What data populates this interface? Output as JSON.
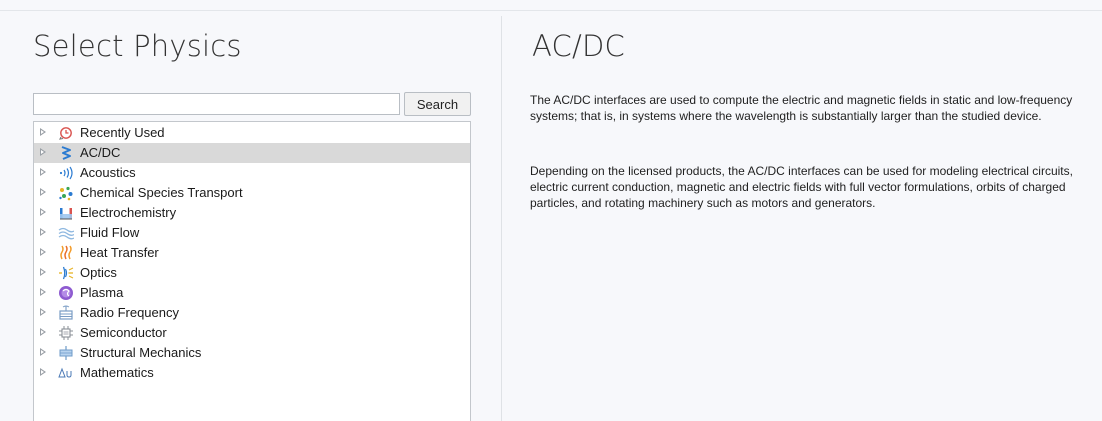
{
  "left_panel": {
    "title": "Select Physics",
    "search": {
      "value": "",
      "placeholder": "",
      "button_label": "Search"
    },
    "tree": [
      {
        "label": "Recently Used",
        "icon": "recently-used-icon",
        "selected": false
      },
      {
        "label": "AC/DC",
        "icon": "acdc-icon",
        "selected": true
      },
      {
        "label": "Acoustics",
        "icon": "acoustics-icon",
        "selected": false
      },
      {
        "label": "Chemical Species Transport",
        "icon": "chemical-species-transport-icon",
        "selected": false
      },
      {
        "label": "Electrochemistry",
        "icon": "electrochemistry-icon",
        "selected": false
      },
      {
        "label": "Fluid Flow",
        "icon": "fluid-flow-icon",
        "selected": false
      },
      {
        "label": "Heat Transfer",
        "icon": "heat-transfer-icon",
        "selected": false
      },
      {
        "label": "Optics",
        "icon": "optics-icon",
        "selected": false
      },
      {
        "label": "Plasma",
        "icon": "plasma-icon",
        "selected": false
      },
      {
        "label": "Radio Frequency",
        "icon": "radio-frequency-icon",
        "selected": false
      },
      {
        "label": "Semiconductor",
        "icon": "semiconductor-icon",
        "selected": false
      },
      {
        "label": "Structural Mechanics",
        "icon": "structural-mechanics-icon",
        "selected": false
      },
      {
        "label": "Mathematics",
        "icon": "mathematics-icon",
        "selected": false
      }
    ]
  },
  "right_panel": {
    "title": "AC/DC",
    "paragraphs": [
      "The AC/DC interfaces are used to compute the electric and magnetic fields in static and low-frequency systems; that is, in systems where the wavelength is substantially larger than the studied device.",
      "Depending on the licensed products, the AC/DC interfaces can be used for modeling electrical circuits, electric current conduction, magnetic and electric fields with full vector formulations, orbits of charged particles, and rotating machinery such as motors and generators."
    ]
  },
  "colors": {
    "background": "#f7f8fb",
    "selected_row": "#d9d9d9",
    "acdc_accent": "#2b7bd1",
    "heat_accent": "#f39c2a",
    "plasma_accent": "#8e5bd0"
  }
}
